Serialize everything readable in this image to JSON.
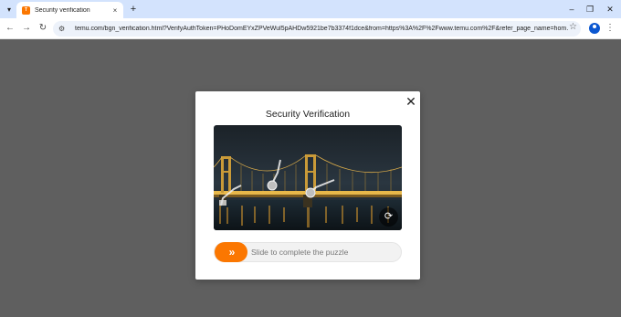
{
  "browser": {
    "tab_title": "Security verification",
    "favicon_text": "T",
    "url": "temu.com/bgn_verification.html?VerifyAuthToken=PHoDomEYxZPVeWul5pAHDw5921be7b3374f1dce&from=https%3A%2F%2Fwww.temu.com%2F&refer_page_name=hom…",
    "icons": {
      "tab_search": "chevron-down",
      "tab_close": "×",
      "new_tab": "+",
      "minimize": "–",
      "restore": "❐",
      "close_window": "✕",
      "back": "←",
      "forward": "→",
      "reload": "↻",
      "site_info": "⚙",
      "bookmark": "☆",
      "menu": "⋮"
    }
  },
  "modal": {
    "title": "Security Verification",
    "close_icon": "✕",
    "refresh_icon": "⟳",
    "slider_icon": "»",
    "slider_label": "Slide to complete the puzzle"
  },
  "colors": {
    "accent": "#fb7701",
    "overlay": "#5f5f5f",
    "tabstrip": "#d3e3fd"
  }
}
